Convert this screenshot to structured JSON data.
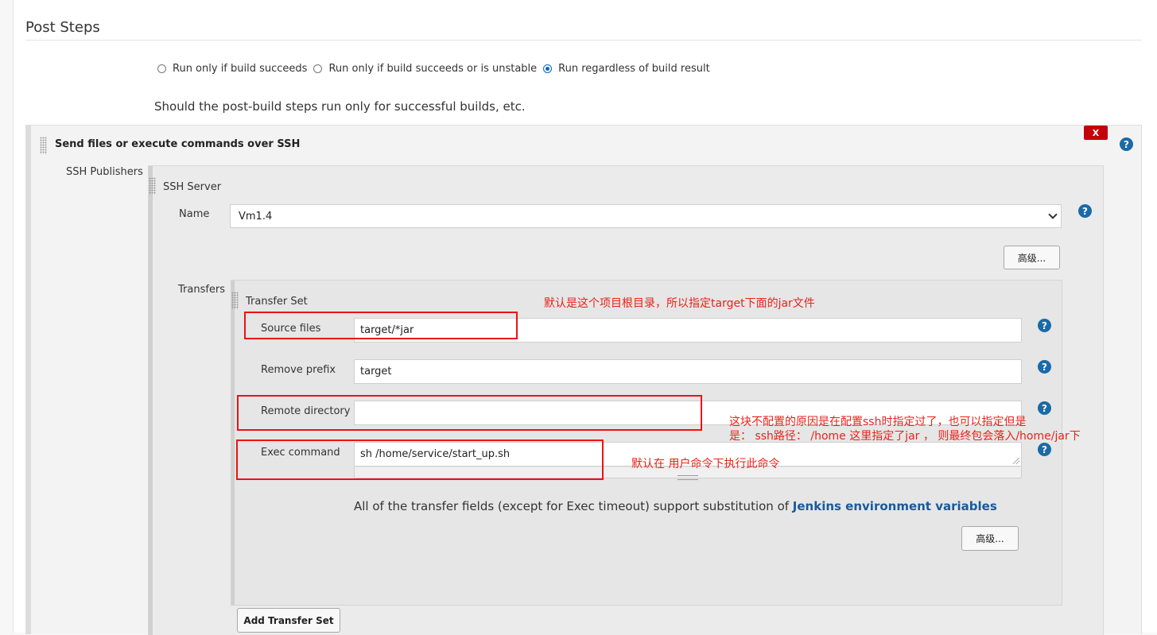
{
  "section": {
    "title": "Post Steps"
  },
  "radios": [
    {
      "label": "Run only if build succeeds",
      "checked": false
    },
    {
      "label": "Run only if build succeeds or is unstable",
      "checked": false
    },
    {
      "label": "Run regardless of build result",
      "checked": true
    }
  ],
  "hint": "Should the post-build steps run only for successful builds, etc.",
  "block": {
    "title": "Send files or execute commands over SSH",
    "delete_label": "X",
    "publishers_label": "SSH Publishers",
    "server_title": "SSH Server",
    "name_label": "Name",
    "name_value": "Vm1.4",
    "advanced_label": "高级...",
    "transfers_label": "Transfers",
    "transfer_set_title": "Transfer Set",
    "source_files_label": "Source files",
    "source_files_value": "target/*jar",
    "remove_prefix_label": "Remove prefix",
    "remove_prefix_value": "target",
    "remote_directory_label": "Remote directory",
    "remote_directory_value": "",
    "exec_command_label": "Exec command",
    "exec_command_value": "sh /home/service/start_up.sh",
    "info_text": "All of the transfer fields (except for Exec timeout) support substitution of ",
    "info_link": "Jenkins environment variables",
    "transfer_advanced_label": "高级...",
    "add_transfer_set_label": "Add Transfer Set",
    "help_glyph": "?"
  },
  "annotations": {
    "note1": "默认是这个项目根目录，所以指定target下面的jar文件",
    "note2_line1": "这块不配置的原因是在配置ssh时指定过了，也可以指定但是",
    "note2_line2": "是： ssh路径： /home  这里指定了jar ， 则最终包会落入/home/jar下",
    "note3": "默认在 用户命令下执行此命令",
    "highlight_color": "#ee1111"
  }
}
